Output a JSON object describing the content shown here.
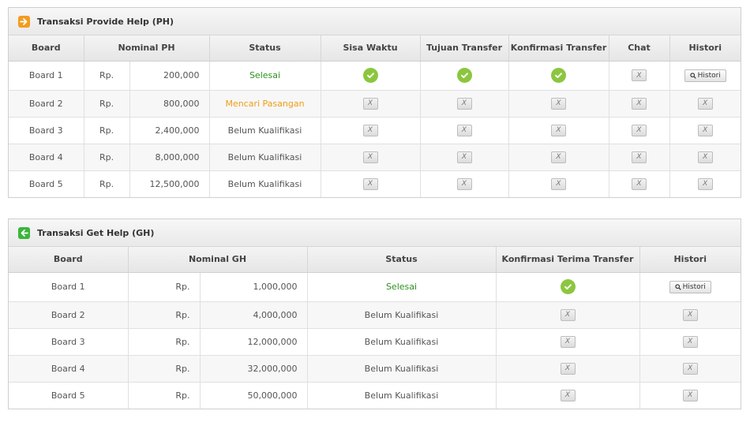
{
  "ph": {
    "title": "Transaksi Provide Help (PH)",
    "headers": {
      "board": "Board",
      "nominal": "Nominal PH",
      "status": "Status",
      "sisa_waktu": "Sisa Waktu",
      "tujuan_transfer": "Tujuan Transfer",
      "konfirmasi_transfer": "Konfirmasi Transfer",
      "chat": "Chat",
      "histori": "Histori"
    },
    "rows": [
      {
        "board": "Board 1",
        "rp": "Rp.",
        "amount": "200,000",
        "status": "Selesai"
      },
      {
        "board": "Board 2",
        "rp": "Rp.",
        "amount": "800,000",
        "status": "Mencari Pasangan"
      },
      {
        "board": "Board 3",
        "rp": "Rp.",
        "amount": "2,400,000",
        "status": "Belum Kualifikasi"
      },
      {
        "board": "Board 4",
        "rp": "Rp.",
        "amount": "8,000,000",
        "status": "Belum Kualifikasi"
      },
      {
        "board": "Board 5",
        "rp": "Rp.",
        "amount": "12,500,000",
        "status": "Belum Kualifikasi"
      }
    ]
  },
  "gh": {
    "title": "Transaksi Get Help (GH)",
    "headers": {
      "board": "Board",
      "nominal": "Nominal GH",
      "status": "Status",
      "konfirmasi_terima": "Konfirmasi Terima Transfer",
      "histori": "Histori"
    },
    "rows": [
      {
        "board": "Board 1",
        "rp": "Rp.",
        "amount": "1,000,000",
        "status": "Selesai"
      },
      {
        "board": "Board 2",
        "rp": "Rp.",
        "amount": "4,000,000",
        "status": "Belum Kualifikasi"
      },
      {
        "board": "Board 3",
        "rp": "Rp.",
        "amount": "12,000,000",
        "status": "Belum Kualifikasi"
      },
      {
        "board": "Board 4",
        "rp": "Rp.",
        "amount": "32,000,000",
        "status": "Belum Kualifikasi"
      },
      {
        "board": "Board 5",
        "rp": "Rp.",
        "amount": "50,000,000",
        "status": "Belum Kualifikasi"
      }
    ]
  },
  "buttons": {
    "histori_label": "Histori",
    "x_label": "X"
  },
  "colors": {
    "accent_orange": "#f39c1f",
    "accent_green": "#3bb53b",
    "status_done": "#2f8f1f",
    "status_searching": "#ef9d14",
    "check_green": "#8cc63f"
  },
  "icons": {
    "ph_header": "arrow-right-icon",
    "gh_header": "arrow-left-icon",
    "done": "check-circle-icon",
    "disabled": "x-button-icon",
    "search": "search-icon"
  }
}
